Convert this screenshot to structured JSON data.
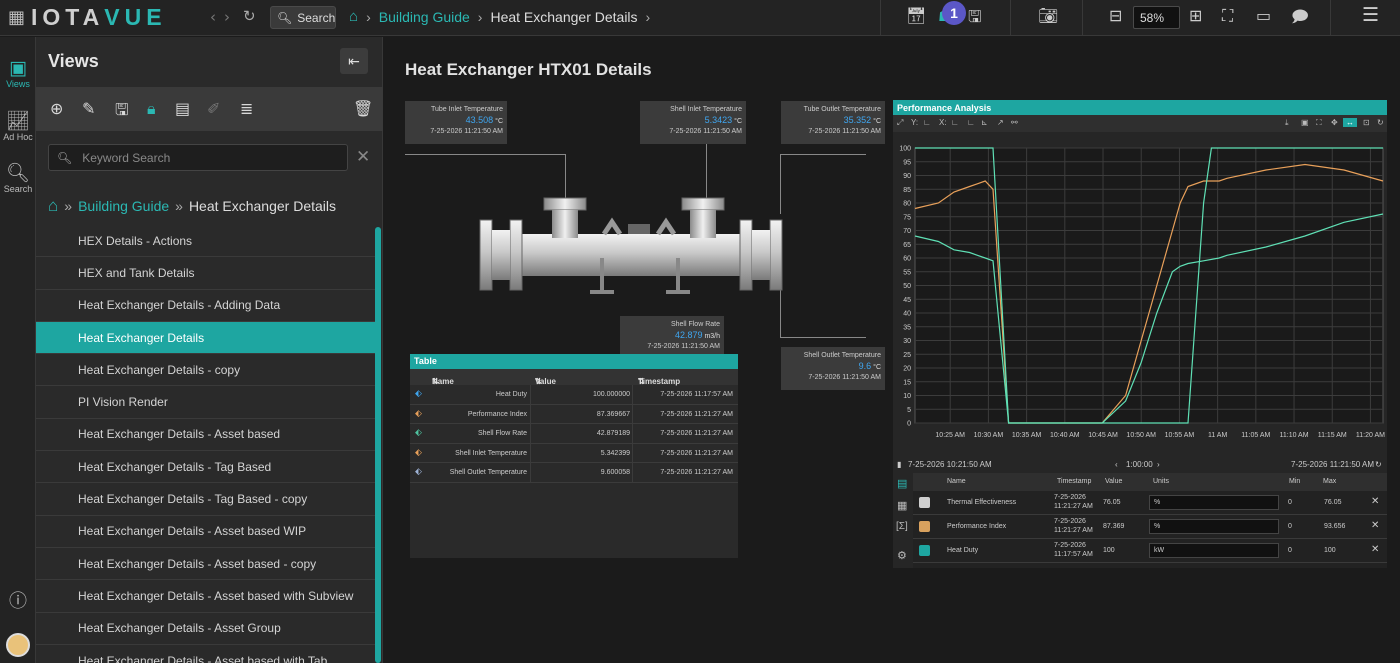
{
  "app": {
    "logo_a": "IOTA",
    "logo_b": "VUE"
  },
  "topbar": {
    "search_label": "Search",
    "crumbs": [
      {
        "label": "Building Guide"
      },
      {
        "label": "Heat Exchanger Details"
      }
    ],
    "notification_count": "1",
    "zoom_value": "58%"
  },
  "rail": [
    {
      "label": "Views"
    },
    {
      "label": "Ad Hoc"
    },
    {
      "label": "Search"
    }
  ],
  "views_panel": {
    "title": "Views",
    "search_placeholder": "Keyword Search",
    "crumbs": [
      {
        "label": "Building Guide"
      },
      {
        "label": "Heat Exchanger Details"
      }
    ],
    "items": [
      "HEX Details - Actions",
      "HEX and Tank Details",
      "Heat Exchanger Details - Adding Data",
      "Heat Exchanger Details",
      "Heat Exchanger Details - copy",
      "PI Vision Render",
      "Heat Exchanger Details - Asset based",
      "Heat Exchanger Details - Tag Based",
      "Heat Exchanger Details - Tag Based - copy",
      "Heat Exchanger Details - Asset based WIP",
      "Heat Exchanger Details - Asset based - copy",
      "Heat Exchanger Details - Asset based with Subview",
      "Heat Exchanger Details - Asset Group",
      "Heat Exchanger Details - Asset based with Tab"
    ],
    "active_index": 3
  },
  "page": {
    "title": "Heat Exchanger HTX01 Details"
  },
  "callouts": {
    "tube_inlet": {
      "label": "Tube Inlet Temperature",
      "value": "43.508",
      "unit": "°C",
      "time": "7-25-2026 11:21:50 AM"
    },
    "shell_inlet": {
      "label": "Shell Inlet Temperature",
      "value": "5.3423",
      "unit": "°C",
      "time": "7-25-2026 11:21:50 AM"
    },
    "tube_outlet": {
      "label": "Tube Outlet Temperature",
      "value": "35.352",
      "unit": "°C",
      "time": "7-25-2026 11:21:50 AM"
    },
    "shell_flow": {
      "label": "Shell Flow Rate",
      "value": "42.879",
      "unit": "m3/h",
      "time": "7-25-2026 11:21:50 AM"
    },
    "shell_outlet": {
      "label": "Shell Outlet Temperature",
      "value": "9.6",
      "unit": "°C",
      "time": "7-25-2026 11:21:50 AM"
    }
  },
  "table": {
    "title": "Table",
    "headers": {
      "name": "Name",
      "value": "Value",
      "timestamp": "Timestamp"
    },
    "rows": [
      {
        "name": "Heat Duty",
        "value": "100.000000",
        "time": "7-25-2026 11:17:57 AM",
        "color": "#3fa6f0"
      },
      {
        "name": "Performance Index",
        "value": "87.369667",
        "time": "7-25-2026 11:21:27 AM",
        "color": "#e8a05a"
      },
      {
        "name": "Shell Flow Rate",
        "value": "42.879189",
        "time": "7-25-2026 11:21:27 AM",
        "color": "#4fc3a0"
      },
      {
        "name": "Shell Inlet Temperature",
        "value": "5.342399",
        "time": "7-25-2026 11:21:27 AM",
        "color": "#e8a05a"
      },
      {
        "name": "Shell Outlet Temperature",
        "value": "9.600058",
        "time": "7-25-2026 11:21:27 AM",
        "color": "#9fb3d6"
      }
    ]
  },
  "performance": {
    "title": "Performance Analysis",
    "toolbar": {
      "y": "Y:",
      "x": "X:"
    },
    "start": "7-25-2026 10:21:50 AM",
    "end": "7-25-2026 11:21:50 AM",
    "duration": "1:00:00",
    "legend_headers": {
      "name": "Name",
      "timestamp": "Timestamp",
      "value": "Value",
      "units": "Units",
      "min": "Min",
      "max": "Max"
    },
    "legend": [
      {
        "name": "Thermal Effectiveness",
        "time_a": "7-25-2026",
        "time_b": "11:21:27 AM",
        "value": "76.05",
        "units": "%",
        "min": "0",
        "max": "76.05",
        "color": "#cfcfcf"
      },
      {
        "name": "Performance Index",
        "time_a": "7-25-2026",
        "time_b": "11:21:27 AM",
        "value": "87.369",
        "units": "%",
        "min": "0",
        "max": "93.656",
        "color": "#d8a15e"
      },
      {
        "name": "Heat Duty",
        "time_a": "7-25-2026",
        "time_b": "11:17:57 AM",
        "value": "100",
        "units": "kW",
        "min": "0",
        "max": "100",
        "color": "#1ea6a1"
      }
    ]
  },
  "chart_data": {
    "type": "line",
    "ylim": [
      0,
      100
    ],
    "yticks": [
      "100",
      "95",
      "90",
      "85",
      "80",
      "75",
      "70",
      "65",
      "60",
      "55",
      "50",
      "45",
      "40",
      "35",
      "30",
      "25",
      "20",
      "15",
      "10",
      "5",
      "0"
    ],
    "xticks": [
      "10:25 AM",
      "10:30 AM",
      "10:35 AM",
      "10:40 AM",
      "10:45 AM",
      "10:50 AM",
      "10:55 AM",
      "11 AM",
      "11:05 AM",
      "11:10 AM",
      "11:15 AM",
      "11:20 AM"
    ],
    "grid": true,
    "series": [
      {
        "color": "#e8a05a",
        "x": [
          0,
          3,
          5,
          7,
          8,
          9,
          10,
          12,
          14,
          15,
          19,
          24,
          27,
          29,
          31,
          33,
          34,
          35,
          37,
          39,
          40,
          45,
          50,
          55,
          60
        ],
        "y": [
          78,
          80,
          84,
          86,
          87,
          88,
          85,
          0,
          0,
          0,
          0,
          0,
          10,
          30,
          50,
          70,
          80,
          86,
          88,
          88,
          89,
          92,
          94,
          92,
          88
        ]
      },
      {
        "color": "#5fe0b5",
        "x": [
          0,
          3,
          5,
          7,
          8,
          9,
          10,
          12,
          14,
          15,
          19,
          24,
          27,
          29,
          31,
          33,
          34,
          35,
          37,
          39,
          40,
          45,
          50,
          55,
          60
        ],
        "y": [
          68,
          66,
          63,
          62,
          61,
          60,
          59,
          0,
          0,
          0,
          0,
          0,
          8,
          22,
          40,
          55,
          57,
          58,
          59,
          60,
          61,
          64,
          68,
          73,
          76
        ]
      },
      {
        "color": "#5fe0b5",
        "x": [
          0,
          9,
          10,
          12,
          14,
          15,
          19,
          25,
          27,
          34,
          35,
          36,
          37,
          38,
          39,
          40,
          45,
          50,
          55,
          60
        ],
        "y": [
          100,
          100,
          100,
          0,
          0,
          0,
          0,
          0,
          0,
          0,
          0,
          40,
          80,
          100,
          100,
          100,
          100,
          100,
          100,
          100
        ]
      }
    ]
  }
}
